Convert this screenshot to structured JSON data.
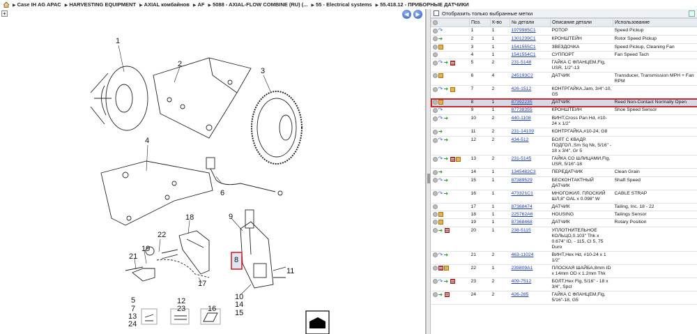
{
  "breadcrumb": [
    {
      "label": "Case IH AG APAC"
    },
    {
      "label": "HARVESTING EQUIPMENT"
    },
    {
      "label": "AXIAL комбайнов"
    },
    {
      "label": "AF"
    },
    {
      "label": "5088 - AXIAL-FLOW COMBINE (RU) (..."
    },
    {
      "label": "55 - Electrical systems"
    },
    {
      "label": "55.418.12 - ПРИБОРНЫЕ ДАТЧИКИ"
    }
  ],
  "filter": {
    "label": "Отобразить только выбранные метки"
  },
  "columns": [
    "",
    "Поз.",
    "К-во",
    "№ детали",
    "Описание детали",
    "Использование"
  ],
  "rows": [
    {
      "pos": "1",
      "qty": "1",
      "part": "1979985C1",
      "desc": "РОТОР",
      "use": "Speed Pickup",
      "icons": [
        "blue"
      ]
    },
    {
      "pos": "2",
      "qty": "1",
      "part": "1301239C1",
      "desc": "КРОНШТЕЙН",
      "use": "Rotor Speed Pickup",
      "icons": [
        "green"
      ]
    },
    {
      "pos": "3",
      "qty": "1",
      "part": "1541555C1",
      "desc": "ЗВЕЗДОЧКА",
      "use": "Speed Pickup, Cleaning Fan",
      "icons": [
        "box"
      ]
    },
    {
      "pos": "4",
      "qty": "1",
      "part": "1541554C1",
      "desc": "СУППОРТ",
      "use": "Fan Speed Tach",
      "icons": []
    },
    {
      "pos": "5",
      "qty": "2",
      "part": "231-5148",
      "desc": "ГАЙКА С ФЛАНЦЕМ,Flg, USR, 1/2\"-13",
      "use": "",
      "icons": [
        "blue",
        "green",
        "doc"
      ]
    },
    {
      "pos": "6",
      "qty": "4",
      "part": "245193C2",
      "desc": "ДАТЧИК",
      "use": "Transducer, Transmission MPH + Fan RPM",
      "icons": [
        "box"
      ]
    },
    {
      "pos": "7",
      "qty": "2",
      "part": "426-1512",
      "desc": "КОНТРГАЙКА,Jam, 3/4\"-10, G5",
      "use": "",
      "icons": [
        "blue",
        "green",
        "box"
      ]
    },
    {
      "pos": "8",
      "qty": "1",
      "part": "87392235",
      "desc": "ДАТЧИК",
      "use": "Reed Non-Contact Normally Open",
      "icons": [
        "box"
      ],
      "selected": true
    },
    {
      "pos": "9",
      "qty": "1",
      "part": "87738355",
      "desc": "КРОНШТЕЙН",
      "use": "Shoe Speed Sensor",
      "icons": [
        "blue"
      ]
    },
    {
      "pos": "10",
      "qty": "2",
      "part": "440-1108",
      "desc": "ВИНТ,Cross Pan Hd, #10-24 x 1/2\"",
      "use": "",
      "icons": [
        "blue",
        "green"
      ]
    },
    {
      "pos": "11",
      "qty": "2",
      "part": "231-14109",
      "desc": "КОНТРГАЙКА,#10-24, G8",
      "use": "",
      "icons": [
        "green"
      ]
    },
    {
      "pos": "12",
      "qty": "2",
      "part": "434-512",
      "desc": "БОЛТ С КВАДР. ПОДГОЛ.,Sm Sq Nk, 5/16\" - 18 x 3/4\", Gr 5",
      "use": "",
      "icons": [
        "blue",
        "green"
      ]
    },
    {
      "pos": "13",
      "qty": "2",
      "part": "231-5145",
      "desc": "ГАЙКА СО ШЛИЦАМИ,Flg, USR, 5/16\"-18",
      "use": "",
      "icons": [
        "blue",
        "green",
        "doc",
        "box"
      ]
    },
    {
      "pos": "14",
      "qty": "1",
      "part": "1345482C3",
      "desc": "ПЕРЕДАТЧИК",
      "use": "Clean Grain",
      "icons": [
        "green"
      ]
    },
    {
      "pos": "15",
      "qty": "1",
      "part": "87389529",
      "desc": "БЕСКОНТАКТНЫЙ ДАТЧИК",
      "use": "Shaft Speed",
      "icons": [
        "blue",
        "green"
      ]
    },
    {
      "pos": "16",
      "qty": "1",
      "part": "473321C1",
      "desc": "МНОГОЖИЛ. ПЛОСКИЙ ШЛ,8\" OAL x 0.098\" W",
      "use": "CABLE STRAP",
      "icons": [
        "blue",
        "green"
      ]
    },
    {
      "pos": "17",
      "qty": "1",
      "part": "87368474",
      "desc": "ДАТЧИК",
      "use": "Tailing, Inc. 18 - 22",
      "icons": []
    },
    {
      "pos": "18",
      "qty": "1",
      "part": "225762A6",
      "desc": "HOUSING",
      "use": "Tailings Sensor",
      "icons": [
        "box"
      ]
    },
    {
      "pos": "19",
      "qty": "1",
      "part": "87368468",
      "desc": "ДАТЧИК",
      "use": "Rotary Position",
      "icons": [
        "box"
      ]
    },
    {
      "pos": "20",
      "qty": "1",
      "part": "238-5115",
      "desc": "УПЛОТНИТЕЛЬНОЕ КОЛЬЦО,0.103\" Thk x 0.674\" ID, - 115, Cl 5, 75 Duro",
      "use": "",
      "icons": [
        "green",
        "doc"
      ]
    },
    {
      "pos": "21",
      "qty": "2",
      "part": "463-11024",
      "desc": "ВИНТ,Hex Hd, #10-24 x 1 1/2\"",
      "use": "",
      "icons": [
        "blue",
        "green"
      ]
    },
    {
      "pos": "22",
      "qty": "1",
      "part": "239809A1",
      "desc": "ПЛОСКАЯ ШАЙБА,8mm ID x 14mm OD x 1.2mm Thk",
      "use": "",
      "icons": [
        "doc",
        "box"
      ]
    },
    {
      "pos": "23",
      "qty": "2",
      "part": "409-7512",
      "desc": "БОЛТ,Hex Flg, 5/16\" - 18 x 3/4\", Spcl",
      "use": "",
      "icons": [
        "blue",
        "green",
        "doc"
      ]
    },
    {
      "pos": "24",
      "qty": "2",
      "part": "426-285",
      "desc": "ГАЙКА С ФЛАНЦЕМ,Flg, 5/16\"-18, G5",
      "use": "",
      "icons": [
        "green",
        "doc"
      ]
    }
  ],
  "callouts": [
    {
      "label": "1"
    },
    {
      "label": "2"
    },
    {
      "label": "3"
    },
    {
      "label": "4"
    },
    {
      "label": "6"
    },
    {
      "label": "18"
    },
    {
      "label": "9"
    },
    {
      "label": "22"
    },
    {
      "label": "19"
    },
    {
      "label": "21"
    },
    {
      "label": "17"
    },
    {
      "label": "8"
    },
    {
      "label": "11"
    },
    {
      "label": "10"
    },
    {
      "label": "14"
    },
    {
      "label": "15"
    },
    {
      "label": "5"
    },
    {
      "label": "7"
    },
    {
      "label": "13"
    },
    {
      "label": "24"
    },
    {
      "label": "12"
    },
    {
      "label": "23"
    },
    {
      "label": "16"
    }
  ]
}
